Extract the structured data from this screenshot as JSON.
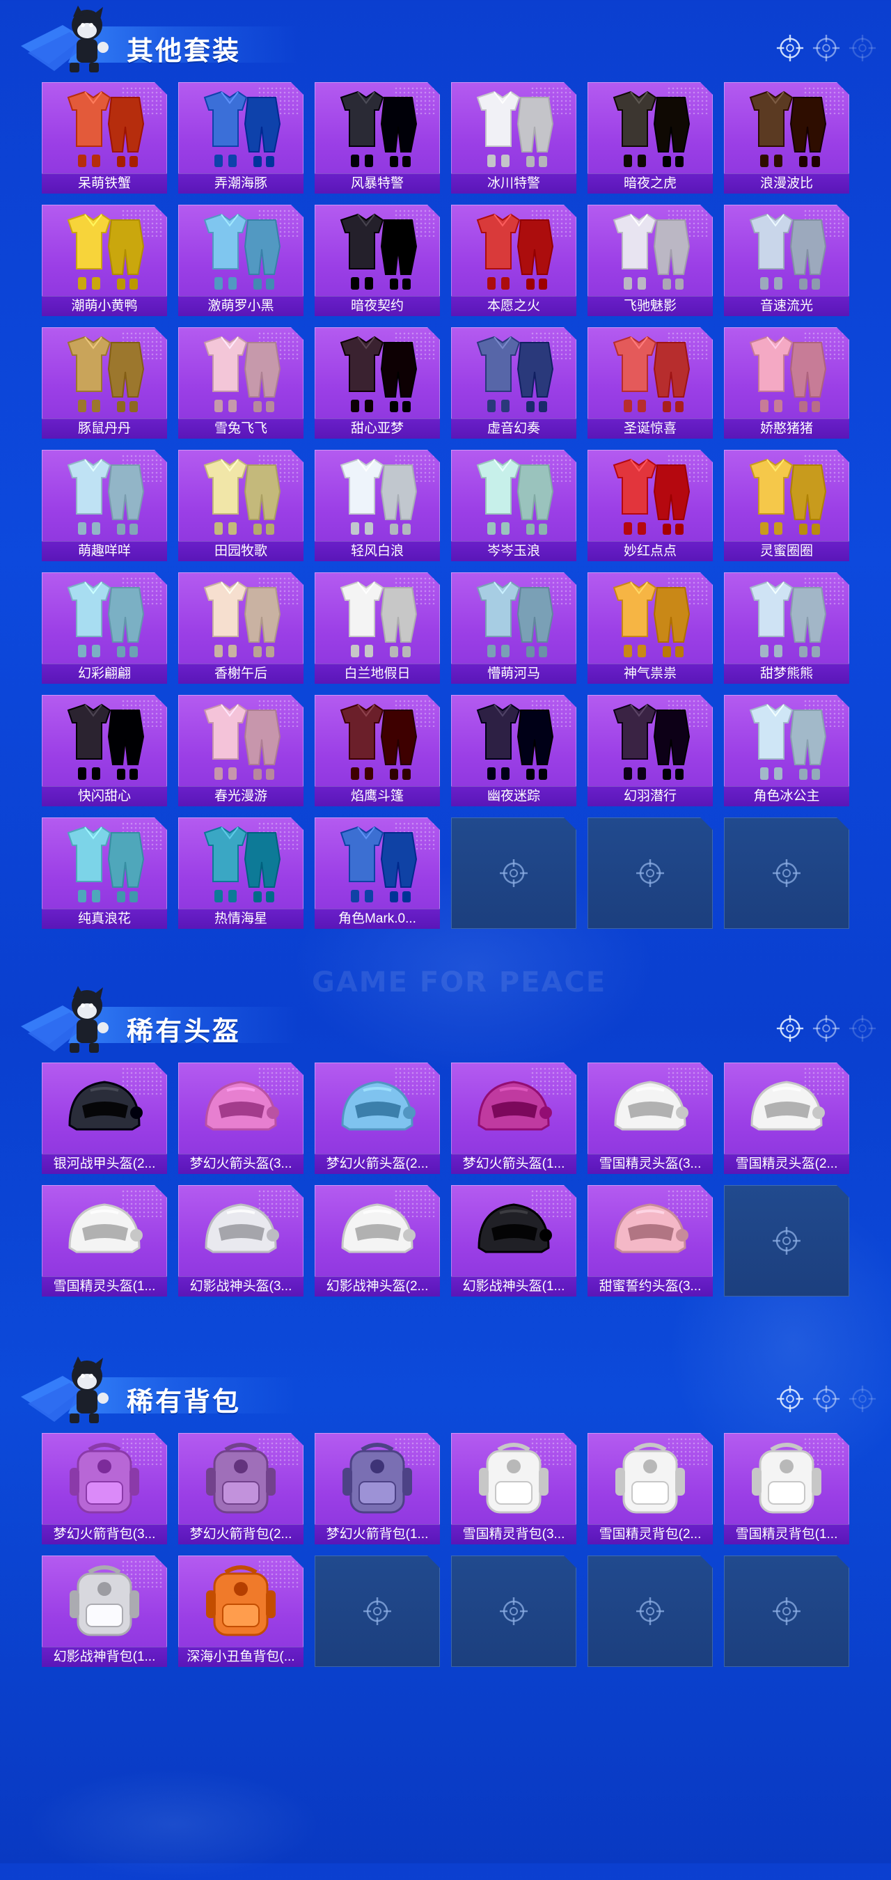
{
  "watermark": "GAME FOR PEACE",
  "sections": [
    {
      "title": "其他套装",
      "items": [
        {
          "label": "呆萌铁蟹",
          "hue": "#e35a3a"
        },
        {
          "label": "弄潮海豚",
          "hue": "#3b6fd8"
        },
        {
          "label": "风暴特警",
          "hue": "#2a2a35"
        },
        {
          "label": "冰川特警",
          "hue": "#f1f1f6"
        },
        {
          "label": "暗夜之虎",
          "hue": "#3c3630"
        },
        {
          "label": "浪漫波比",
          "hue": "#5b3a22"
        },
        {
          "label": "潮萌小黄鸭",
          "hue": "#f7d43a"
        },
        {
          "label": "激萌罗小黑",
          "hue": "#7fc6ef"
        },
        {
          "label": "暗夜契约",
          "hue": "#24202b"
        },
        {
          "label": "本愿之火",
          "hue": "#d93a3a"
        },
        {
          "label": "飞驰魅影",
          "hue": "#e8e4f1"
        },
        {
          "label": "音速流光",
          "hue": "#c9d6ea"
        },
        {
          "label": "豚鼠丹丹",
          "hue": "#c9a45a"
        },
        {
          "label": "雪兔飞飞",
          "hue": "#f3c6d8"
        },
        {
          "label": "甜心亚梦",
          "hue": "#3a2230"
        },
        {
          "label": "虚音幻奏",
          "hue": "#5766a8"
        },
        {
          "label": "圣诞惊喜",
          "hue": "#e45a5a"
        },
        {
          "label": "娇憨猪猪",
          "hue": "#f4a9c4"
        },
        {
          "label": "萌趣咩咩",
          "hue": "#bfe2f4"
        },
        {
          "label": "田园牧歌",
          "hue": "#f1e6a8"
        },
        {
          "label": "轻风白浪",
          "hue": "#eef4fb"
        },
        {
          "label": "岑岑玉浪",
          "hue": "#c7f0ea"
        },
        {
          "label": "妙红点点",
          "hue": "#e2353c"
        },
        {
          "label": "灵蜜圈圈",
          "hue": "#f5c84a"
        },
        {
          "label": "幻彩翩翩",
          "hue": "#a8ddf1"
        },
        {
          "label": "香榭午后",
          "hue": "#f6dfcf"
        },
        {
          "label": "白兰地假日",
          "hue": "#f4f4f4"
        },
        {
          "label": "懵萌河马",
          "hue": "#a7cde3"
        },
        {
          "label": "神气祟祟",
          "hue": "#f6b544"
        },
        {
          "label": "甜梦熊熊",
          "hue": "#cfe3f4"
        },
        {
          "label": "快闪甜心",
          "hue": "#2b2330"
        },
        {
          "label": "春光漫游",
          "hue": "#f4c3d9"
        },
        {
          "label": "焰鹰斗篷",
          "hue": "#6b1f2a"
        },
        {
          "label": "幽夜迷踪",
          "hue": "#2d2044"
        },
        {
          "label": "幻羽潜行",
          "hue": "#3a2344"
        },
        {
          "label": "角色冰公主",
          "hue": "#cfe6f6"
        },
        {
          "label": "纯真浪花",
          "hue": "#7cd4e8"
        },
        {
          "label": "热情海星",
          "hue": "#3aa7c4"
        },
        {
          "label": "角色Mark.0...",
          "hue": "#3c6fd2"
        }
      ],
      "empty_count": 3
    },
    {
      "title": "稀有头盔",
      "items": [
        {
          "label": "银河战甲头盔(2...",
          "hue": "#2a2d3a"
        },
        {
          "label": "梦幻火箭头盔(3...",
          "hue": "#e77fd0"
        },
        {
          "label": "梦幻火箭头盔(2...",
          "hue": "#7fc3ef"
        },
        {
          "label": "梦幻火箭头盔(1...",
          "hue": "#c03aa0"
        },
        {
          "label": "雪国精灵头盔(3...",
          "hue": "#f4f4f4"
        },
        {
          "label": "雪国精灵头盔(2...",
          "hue": "#f4f4f4"
        },
        {
          "label": "雪国精灵头盔(1...",
          "hue": "#f4f4f4"
        },
        {
          "label": "幻影战神头盔(3...",
          "hue": "#e9e9ef"
        },
        {
          "label": "幻影战神头盔(2...",
          "hue": "#f4f4f4"
        },
        {
          "label": "幻影战神头盔(1...",
          "hue": "#202026"
        },
        {
          "label": "甜蜜誓约头盔(3...",
          "hue": "#f4b8c7"
        }
      ],
      "empty_count": 1
    },
    {
      "title": "稀有背包",
      "items": [
        {
          "label": "梦幻火箭背包(3...",
          "hue": "#b867d6"
        },
        {
          "label": "梦幻火箭背包(2...",
          "hue": "#9f6fb9"
        },
        {
          "label": "梦幻火箭背包(1...",
          "hue": "#7a6fb3"
        },
        {
          "label": "雪国精灵背包(3...",
          "hue": "#f4f4f4"
        },
        {
          "label": "雪国精灵背包(2...",
          "hue": "#f4f4f4"
        },
        {
          "label": "雪国精灵背包(1...",
          "hue": "#f4f4f4"
        },
        {
          "label": "幻影战神背包(1...",
          "hue": "#d8d8de"
        },
        {
          "label": "深海小丑鱼背包(...",
          "hue": "#f07a2a"
        }
      ],
      "empty_count": 4
    }
  ],
  "icons": {
    "header_mascot": "mascot-icon",
    "header_markers": "crosshair-icon",
    "empty_slot": "crosshair-icon"
  },
  "colors": {
    "background": "#0b3fd0",
    "card_fill": "#9b3fe6",
    "label_bar": "#6a1fc9",
    "empty_slot": "#214a8e"
  }
}
